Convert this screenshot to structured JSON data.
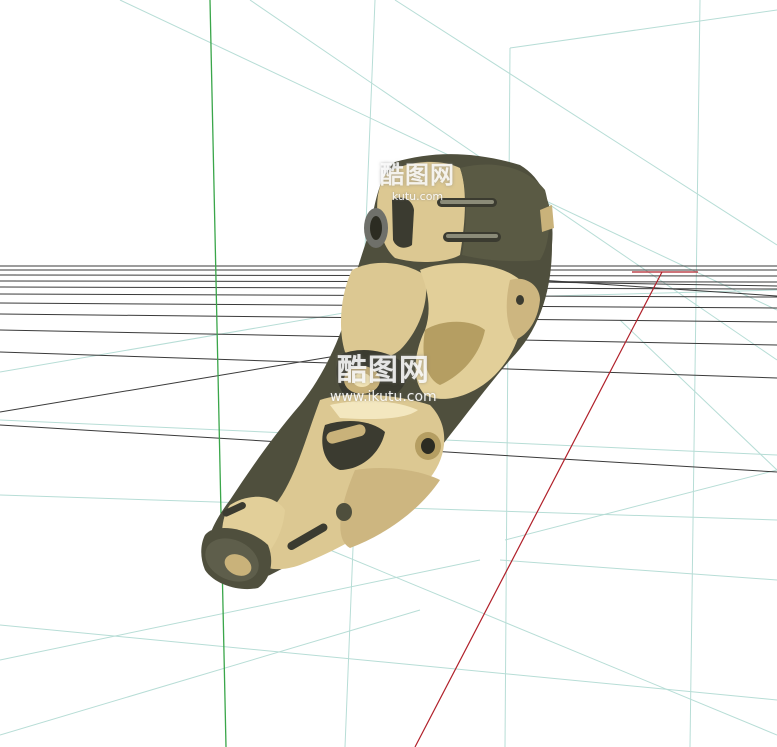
{
  "viewport": {
    "background": "#ffffff",
    "grid_color": "#b7ddd6",
    "ground_line_color": "#2a2a2a",
    "axis_y_color": "#3aa64a",
    "axis_x_color": "#b0202a"
  },
  "model": {
    "name": "mechanical-arm-armor",
    "colors": {
      "plate": "#dcc892",
      "plate_shadow": "#b59e62",
      "plate_highlight": "#f3e7bf",
      "under": "#4f4f3d",
      "under_dark": "#2c2c22",
      "metal": "#6f706a"
    }
  },
  "watermarks": [
    {
      "main": "酷图网",
      "sub": "kutu.com"
    },
    {
      "main": "酷图网",
      "sub": "www.ikutu.com"
    }
  ]
}
